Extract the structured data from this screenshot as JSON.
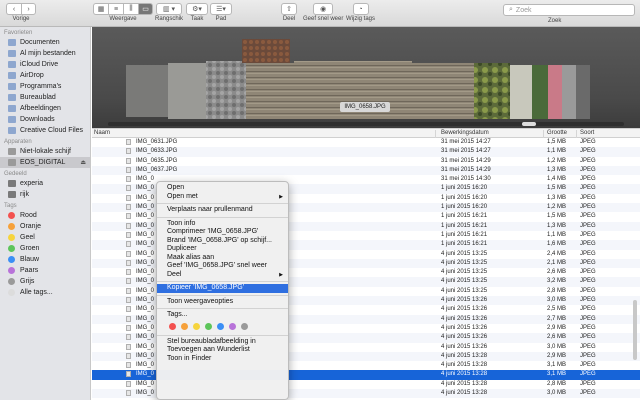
{
  "toolbar": {
    "back_label": "Vorige",
    "view_label": "Weergave",
    "arrange_label": "Rangschik",
    "action_label": "Taak",
    "path_label": "Pad",
    "share_label": "Deel",
    "quicklook_label": "Geef snel weer",
    "tags_label": "Wijzig tags",
    "search_placeholder": "Zoek",
    "search_label": "Zoek"
  },
  "sidebar": {
    "favorites_header": "Favorieten",
    "favorites": [
      "Documenten",
      "Al mijn bestanden",
      "iCloud Drive",
      "AirDrop",
      "Programma's",
      "Bureaublad",
      "Afbeeldingen",
      "Downloads",
      "Creative Cloud Files"
    ],
    "devices_header": "Apparaten",
    "devices": [
      "Niet-lokale schijf",
      "EOS_DIGITAL"
    ],
    "shared_header": "Gedeeld",
    "shared": [
      "experia",
      "rijk"
    ],
    "tags_header": "Tags",
    "tags": [
      {
        "label": "Rood",
        "color": "#f3514f"
      },
      {
        "label": "Oranje",
        "color": "#f6a13a"
      },
      {
        "label": "Geel",
        "color": "#f6d43d"
      },
      {
        "label": "Groen",
        "color": "#5dc55a"
      },
      {
        "label": "Blauw",
        "color": "#3b8ff5"
      },
      {
        "label": "Paars",
        "color": "#b873d9"
      },
      {
        "label": "Grijs",
        "color": "#9a9a9a"
      },
      {
        "label": "Alle tags...",
        "color": "#dcdcdc"
      }
    ]
  },
  "coverflow": {
    "caption": "IMG_0658.JPG"
  },
  "list": {
    "columns": {
      "name": "Naam",
      "date": "Bewerkingsdatum",
      "size": "Grootte",
      "kind": "Soort"
    },
    "rows": [
      {
        "name": "IMG_0631.JPG",
        "date": "31 mei 2015 14:27",
        "size": "1,5 MB",
        "kind": "JPEG"
      },
      {
        "name": "IMG_0633.JPG",
        "date": "31 mei 2015 14:27",
        "size": "1,1 MB",
        "kind": "JPEG"
      },
      {
        "name": "IMG_0635.JPG",
        "date": "31 mei 2015 14:29",
        "size": "1,2 MB",
        "kind": "JPEG"
      },
      {
        "name": "IMG_0637.JPG",
        "date": "31 mei 2015 14:29",
        "size": "1,3 MB",
        "kind": "JPEG"
      },
      {
        "name": "IMG_0",
        "date": "31 mei 2015 14:30",
        "size": "1,4 MB",
        "kind": "JPEG"
      },
      {
        "name": "IMG_0",
        "date": "1 juni 2015 16:20",
        "size": "1,5 MB",
        "kind": "JPEG"
      },
      {
        "name": "IMG_0",
        "date": "1 juni 2015 16:20",
        "size": "1,3 MB",
        "kind": "JPEG"
      },
      {
        "name": "IMG_0",
        "date": "1 juni 2015 16:20",
        "size": "1,2 MB",
        "kind": "JPEG"
      },
      {
        "name": "IMG_0",
        "date": "1 juni 2015 16:21",
        "size": "1,5 MB",
        "kind": "JPEG"
      },
      {
        "name": "IMG_0",
        "date": "1 juni 2015 16:21",
        "size": "1,3 MB",
        "kind": "JPEG"
      },
      {
        "name": "IMG_0",
        "date": "1 juni 2015 16:21",
        "size": "1,1 MB",
        "kind": "JPEG"
      },
      {
        "name": "IMG_0",
        "date": "1 juni 2015 16:21",
        "size": "1,6 MB",
        "kind": "JPEG"
      },
      {
        "name": "IMG_0",
        "date": "4 juni 2015 13:25",
        "size": "2,4 MB",
        "kind": "JPEG"
      },
      {
        "name": "IMG_0",
        "date": "4 juni 2015 13:25",
        "size": "2,1 MB",
        "kind": "JPEG"
      },
      {
        "name": "IMG_0",
        "date": "4 juni 2015 13:25",
        "size": "2,6 MB",
        "kind": "JPEG"
      },
      {
        "name": "IMG_0",
        "date": "4 juni 2015 13:25",
        "size": "3,2 MB",
        "kind": "JPEG"
      },
      {
        "name": "IMG_0",
        "date": "4 juni 2015 13:25",
        "size": "2,8 MB",
        "kind": "JPEG"
      },
      {
        "name": "IMG_0",
        "date": "4 juni 2015 13:26",
        "size": "3,0 MB",
        "kind": "JPEG"
      },
      {
        "name": "IMG_0",
        "date": "4 juni 2015 13:26",
        "size": "2,5 MB",
        "kind": "JPEG"
      },
      {
        "name": "IMG_0",
        "date": "4 juni 2015 13:26",
        "size": "2,7 MB",
        "kind": "JPEG"
      },
      {
        "name": "IMG_0",
        "date": "4 juni 2015 13:26",
        "size": "2,9 MB",
        "kind": "JPEG"
      },
      {
        "name": "IMG_0",
        "date": "4 juni 2015 13:26",
        "size": "2,6 MB",
        "kind": "JPEG"
      },
      {
        "name": "IMG_0",
        "date": "4 juni 2015 13:26",
        "size": "3,0 MB",
        "kind": "JPEG"
      },
      {
        "name": "IMG_0",
        "date": "4 juni 2015 13:28",
        "size": "2,9 MB",
        "kind": "JPEG"
      },
      {
        "name": "IMG_0",
        "date": "4 juni 2015 13:28",
        "size": "3,1 MB",
        "kind": "JPEG"
      },
      {
        "name": "IMG_0",
        "date": "4 juni 2015 13:28",
        "size": "3,1 MB",
        "kind": "JPEG"
      },
      {
        "name": "IMG_0",
        "date": "4 juni 2015 13:28",
        "size": "2,8 MB",
        "kind": "JPEG"
      },
      {
        "name": "IMG_0",
        "date": "4 juni 2015 13:28",
        "size": "3,0 MB",
        "kind": "JPEG"
      }
    ],
    "selected_index": 25
  },
  "context_menu": {
    "items": [
      {
        "label": "Open",
        "submenu": false
      },
      {
        "label": "Open met",
        "submenu": true
      },
      {
        "sep": true
      },
      {
        "label": "Verplaats naar prullenmand",
        "submenu": false
      },
      {
        "sep": true
      },
      {
        "label": "Toon info",
        "submenu": false
      },
      {
        "label": "Comprimeer 'IMG_0658.JPG'",
        "submenu": false
      },
      {
        "label": "Brand 'IMG_0658.JPG' op schijf...",
        "submenu": false
      },
      {
        "label": "Dupliceer",
        "submenu": false
      },
      {
        "label": "Maak alias aan",
        "submenu": false
      },
      {
        "label": "Geef 'IMG_0658.JPG' snel weer",
        "submenu": false
      },
      {
        "label": "Deel",
        "submenu": true
      },
      {
        "sep": true
      },
      {
        "label": "Kopieer 'IMG_0658.JPG'",
        "submenu": false,
        "highlighted": true
      },
      {
        "sep": true
      },
      {
        "label": "Toon weergaveopties",
        "submenu": false
      },
      {
        "sep": true
      },
      {
        "label": "Tags...",
        "submenu": false
      },
      {
        "tags": true
      },
      {
        "sep": true
      },
      {
        "label": "Stel bureaubladafbeelding in",
        "submenu": false
      },
      {
        "label": "Toevoegen aan Wunderlist",
        "submenu": false
      },
      {
        "label": "Toon in Finder",
        "submenu": false
      }
    ],
    "tag_colors": [
      "#f3514f",
      "#f6a13a",
      "#f6d43d",
      "#5dc55a",
      "#3b8ff5",
      "#b873d9",
      "#9a9a9a"
    ]
  }
}
